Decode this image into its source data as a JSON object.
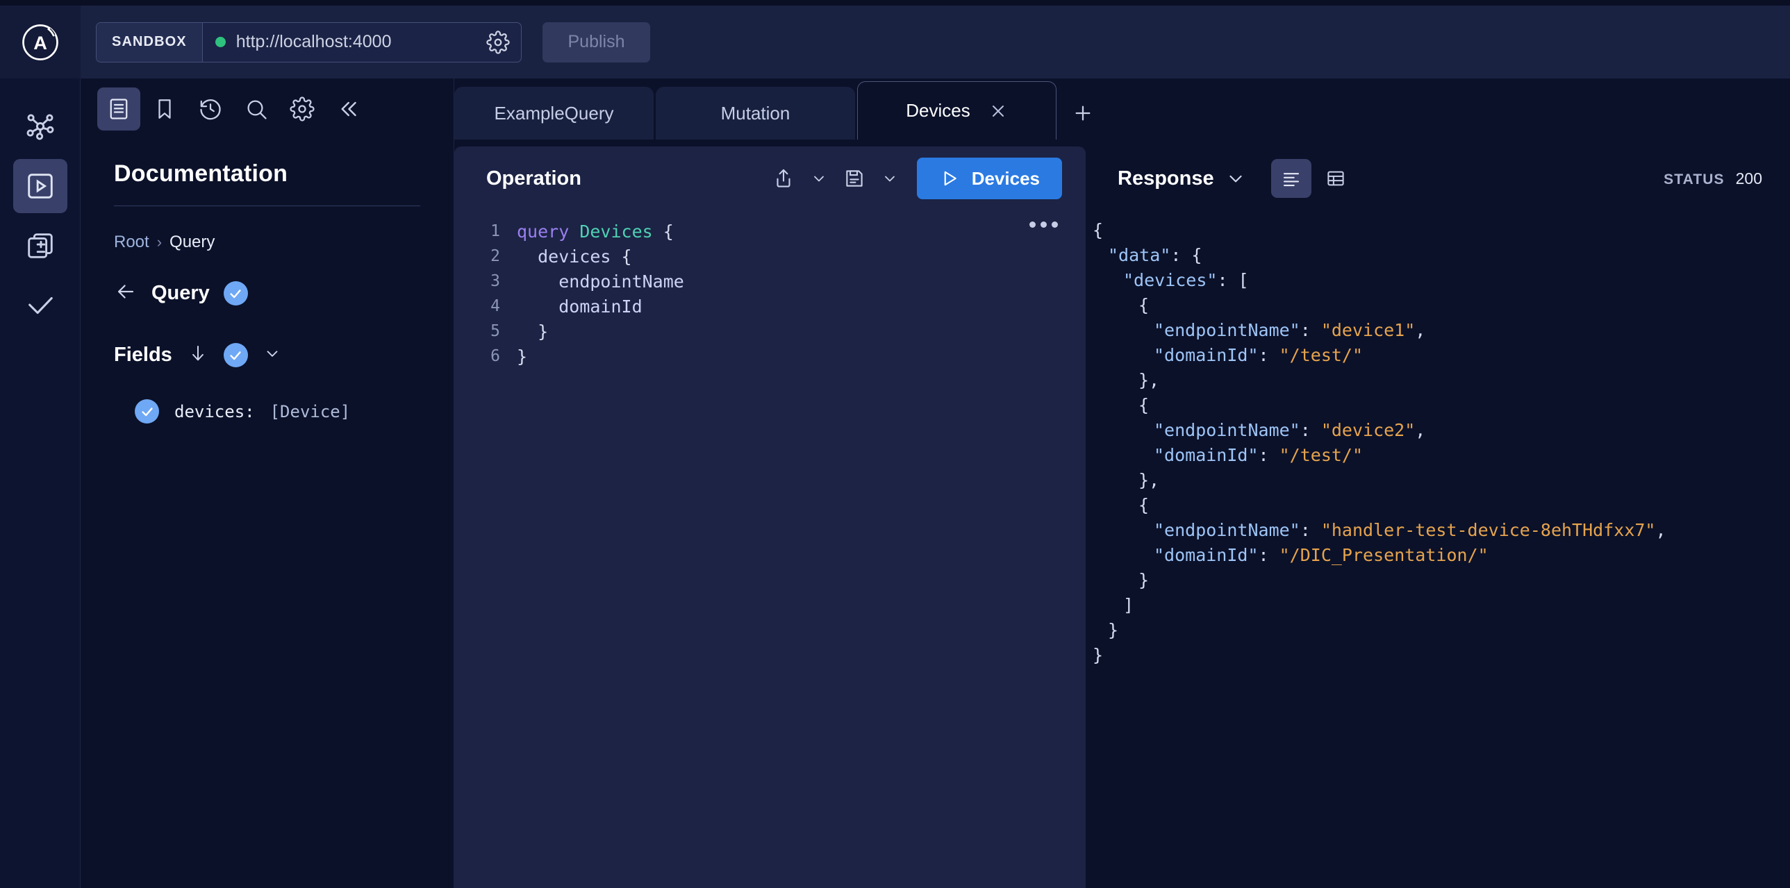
{
  "header": {
    "logo_name": "apollo-logo",
    "sandbox_badge": "SANDBOX",
    "endpoint_url": "http://localhost:4000",
    "endpoint_status": "connected",
    "settings_icon": "gear-icon",
    "publish_label": "Publish"
  },
  "rail": {
    "items": [
      {
        "name": "graph-icon",
        "label": "Graph",
        "active": false
      },
      {
        "name": "explorer-play-icon",
        "label": "Explorer",
        "active": true
      },
      {
        "name": "schema-diff-icon",
        "label": "Schema Diff",
        "active": false
      },
      {
        "name": "checks-check-icon",
        "label": "Checks",
        "active": false
      }
    ]
  },
  "docs": {
    "toolbar": [
      {
        "name": "documentation-icon",
        "label": "Documentation",
        "active": true
      },
      {
        "name": "bookmark-icon",
        "label": "Saved Operations",
        "active": false
      },
      {
        "name": "history-icon",
        "label": "History",
        "active": false
      },
      {
        "name": "search-icon",
        "label": "Search",
        "active": false
      },
      {
        "name": "gear-icon",
        "label": "Settings",
        "active": false
      },
      {
        "name": "collapse-left-icon",
        "label": "Collapse",
        "active": false
      }
    ],
    "title": "Documentation",
    "breadcrumb": {
      "root": "Root",
      "separator": "›",
      "current": "Query"
    },
    "type_row": {
      "back_label": "back",
      "type_name": "Query",
      "badge": "check"
    },
    "fields_row": {
      "label": "Fields",
      "sort_icon": "arrow-down-icon",
      "badge": "check",
      "chevron": "chevron-down-icon"
    },
    "fields": [
      {
        "badge": "check",
        "name": "devices:",
        "type": "[Device]"
      }
    ]
  },
  "tabs": {
    "items": [
      {
        "label": "ExampleQuery",
        "active": false,
        "closable": false
      },
      {
        "label": "Mutation",
        "active": false,
        "closable": false
      },
      {
        "label": "Devices",
        "active": true,
        "closable": true
      }
    ],
    "add_label": "+"
  },
  "operation": {
    "title": "Operation",
    "share_icon": "share-icon",
    "share_chevron": "chevron-down-icon",
    "save_icon": "save-floppy-icon",
    "save_chevron": "chevron-down-icon",
    "run_label": "Devices",
    "run_icon": "play-icon",
    "more_icon": "more-horizontal-icon",
    "code_lines": [
      {
        "n": "1",
        "tokens": [
          {
            "t": "kw",
            "v": "query "
          },
          {
            "t": "opname",
            "v": "Devices"
          },
          {
            "t": "punct",
            "v": " {"
          }
        ]
      },
      {
        "n": "2",
        "tokens": [
          {
            "t": "punct",
            "v": "  "
          },
          {
            "t": "fieldname",
            "v": "devices"
          },
          {
            "t": "punct",
            "v": " {"
          }
        ]
      },
      {
        "n": "3",
        "tokens": [
          {
            "t": "punct",
            "v": "    "
          },
          {
            "t": "fieldname",
            "v": "endpointName"
          }
        ]
      },
      {
        "n": "4",
        "tokens": [
          {
            "t": "punct",
            "v": "    "
          },
          {
            "t": "fieldname",
            "v": "domainId"
          }
        ]
      },
      {
        "n": "5",
        "tokens": [
          {
            "t": "punct",
            "v": "  }"
          }
        ]
      },
      {
        "n": "6",
        "tokens": [
          {
            "t": "punct",
            "v": "}"
          }
        ]
      }
    ]
  },
  "response": {
    "title": "Response",
    "chevron": "chevron-down-icon",
    "view_modes": [
      {
        "name": "json-view-icon",
        "label": "JSON",
        "active": true
      },
      {
        "name": "table-view-icon",
        "label": "Table",
        "active": false
      }
    ],
    "status_label": "STATUS",
    "status_code": "200",
    "json_lines": [
      {
        "indent": 0,
        "tokens": [
          {
            "t": "jpunct",
            "v": "{"
          }
        ]
      },
      {
        "indent": 1,
        "tokens": [
          {
            "t": "jkey",
            "v": "\"data\""
          },
          {
            "t": "jpunct",
            "v": ": {"
          }
        ]
      },
      {
        "indent": 2,
        "tokens": [
          {
            "t": "jkey",
            "v": "\"devices\""
          },
          {
            "t": "jpunct",
            "v": ": ["
          }
        ]
      },
      {
        "indent": 3,
        "tokens": [
          {
            "t": "jpunct",
            "v": "{"
          }
        ]
      },
      {
        "indent": 4,
        "tokens": [
          {
            "t": "jkey",
            "v": "\"endpointName\""
          },
          {
            "t": "jpunct",
            "v": ": "
          },
          {
            "t": "jstr",
            "v": "\"device1\""
          },
          {
            "t": "jpunct",
            "v": ","
          }
        ]
      },
      {
        "indent": 4,
        "tokens": [
          {
            "t": "jkey",
            "v": "\"domainId\""
          },
          {
            "t": "jpunct",
            "v": ": "
          },
          {
            "t": "jstr",
            "v": "\"/test/\""
          }
        ]
      },
      {
        "indent": 3,
        "tokens": [
          {
            "t": "jpunct",
            "v": "},"
          }
        ]
      },
      {
        "indent": 3,
        "tokens": [
          {
            "t": "jpunct",
            "v": "{"
          }
        ]
      },
      {
        "indent": 4,
        "tokens": [
          {
            "t": "jkey",
            "v": "\"endpointName\""
          },
          {
            "t": "jpunct",
            "v": ": "
          },
          {
            "t": "jstr",
            "v": "\"device2\""
          },
          {
            "t": "jpunct",
            "v": ","
          }
        ]
      },
      {
        "indent": 4,
        "tokens": [
          {
            "t": "jkey",
            "v": "\"domainId\""
          },
          {
            "t": "jpunct",
            "v": ": "
          },
          {
            "t": "jstr",
            "v": "\"/test/\""
          }
        ]
      },
      {
        "indent": 3,
        "tokens": [
          {
            "t": "jpunct",
            "v": "},"
          }
        ]
      },
      {
        "indent": 3,
        "tokens": [
          {
            "t": "jpunct",
            "v": "{"
          }
        ]
      },
      {
        "indent": 4,
        "tokens": [
          {
            "t": "jkey",
            "v": "\"endpointName\""
          },
          {
            "t": "jpunct",
            "v": ": "
          },
          {
            "t": "jstr",
            "v": "\"handler-test-device-8ehTHdfxx7\""
          },
          {
            "t": "jpunct",
            "v": ","
          }
        ]
      },
      {
        "indent": 4,
        "tokens": [
          {
            "t": "jkey",
            "v": "\"domainId\""
          },
          {
            "t": "jpunct",
            "v": ": "
          },
          {
            "t": "jstr",
            "v": "\"/DIC_Presentation/\""
          }
        ]
      },
      {
        "indent": 3,
        "tokens": [
          {
            "t": "jpunct",
            "v": "}"
          }
        ]
      },
      {
        "indent": 2,
        "tokens": [
          {
            "t": "jpunct",
            "v": "]"
          }
        ]
      },
      {
        "indent": 1,
        "tokens": [
          {
            "t": "jpunct",
            "v": "}"
          }
        ]
      },
      {
        "indent": 0,
        "tokens": [
          {
            "t": "jpunct",
            "v": "}"
          }
        ]
      }
    ]
  },
  "colors": {
    "accent_blue": "#2a7ae2",
    "badge_blue": "#6fa8f5",
    "status_green": "#2ec27e",
    "string_orange": "#e6a44e",
    "keyword_purple": "#9a7ff0",
    "opname_teal": "#4fd1b3",
    "panel_bg": "#1c2344",
    "app_bg": "#0b1129"
  }
}
